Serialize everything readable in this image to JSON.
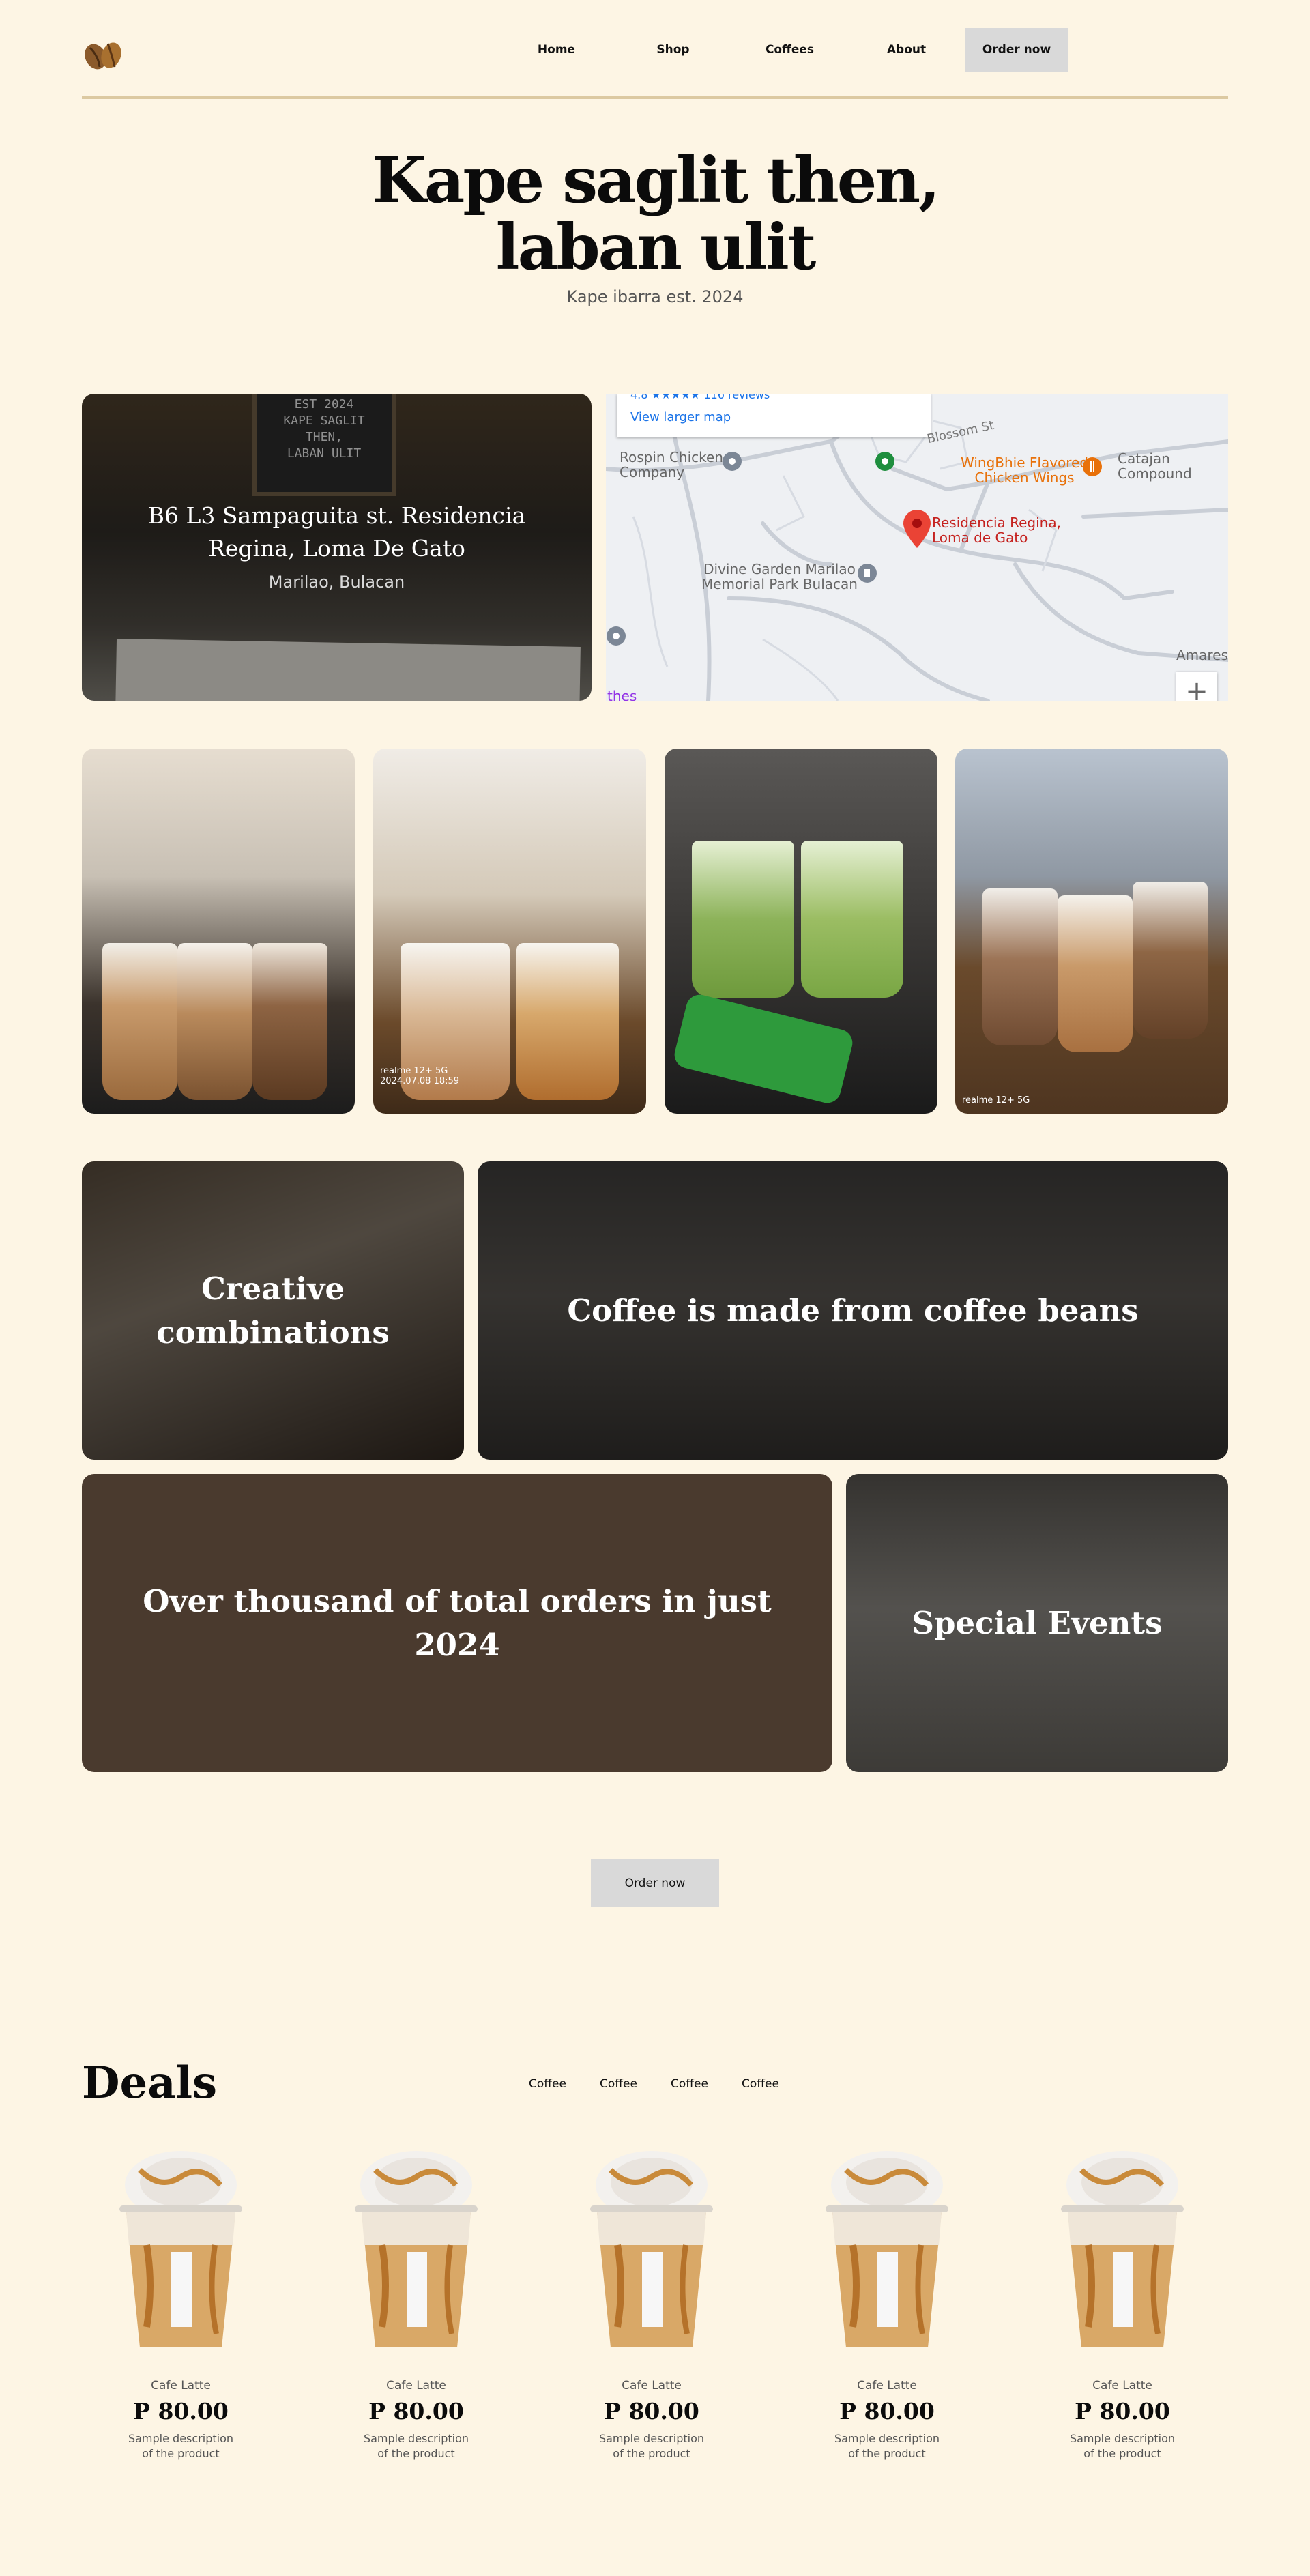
{
  "nav": {
    "links": [
      "Home",
      "Shop",
      "Coffees",
      "About"
    ],
    "cta": "Order now"
  },
  "hero": {
    "title_line1": "Kape saglit then,",
    "title_line2": "laban ulit",
    "subtitle": "Kape ibarra est. 2024"
  },
  "location": {
    "board_lines": [
      "EST 2024",
      "KAPE SAGLIT",
      "THEN,",
      "LABAN ULIT"
    ],
    "address": "B6 L3 Sampaguita st. Residencia Regina, Loma De Gato",
    "city": "Marilao, Bulacan"
  },
  "map": {
    "reviews_text": "4.8 ★★★★★  116 reviews",
    "larger_map": "View larger map",
    "labels": {
      "rospin": "Rospin Chicken\nCompany",
      "blossom": "Blossom St",
      "wingbhie": "WingBhie Flavored\nChicken Wings",
      "catajan": "Catajan Compound",
      "residencia": "Residencia Regina,\nLoma de Gato",
      "divine": "Divine Garden Marilao\nMemorial Park Bulacan",
      "amares": "Amares",
      "thes": "thes"
    },
    "zoom": "+"
  },
  "photos": [
    {
      "caption": ""
    },
    {
      "caption": "realme 12+ 5G\n2024.07.08 18:59"
    },
    {
      "caption": ""
    },
    {
      "caption": "realme 12+ 5G"
    }
  ],
  "features": {
    "creative": "Creative combinations",
    "beans": "Coffee is made from coffee beans",
    "orders": "Over thousand of total orders in just 2024",
    "events": "Special Events"
  },
  "order_button": "Order now",
  "deals": {
    "title": "Deals",
    "filters": [
      "Coffee",
      "Coffee",
      "Coffee",
      "Coffee"
    ],
    "products": [
      {
        "name": "Cafe Latte",
        "price": "P 80.00",
        "desc": "Sample description of the product"
      },
      {
        "name": "Cafe Latte",
        "price": "P 80.00",
        "desc": "Sample description of the product"
      },
      {
        "name": "Cafe Latte",
        "price": "P 80.00",
        "desc": "Sample description of the product"
      },
      {
        "name": "Cafe Latte",
        "price": "P 80.00",
        "desc": "Sample description of the product"
      },
      {
        "name": "Cafe Latte",
        "price": "P 80.00",
        "desc": "Sample description of the product"
      }
    ]
  },
  "colors": {
    "background": "#fdf5e4",
    "rule": "#dcc9a1",
    "button": "#d9d9d9",
    "orders_tile": "#4a3a2e",
    "map_pin": "#ea4335"
  },
  "icons": [
    "coffee-beans-logo-icon",
    "map-pin-icon",
    "zoom-plus-icon"
  ]
}
